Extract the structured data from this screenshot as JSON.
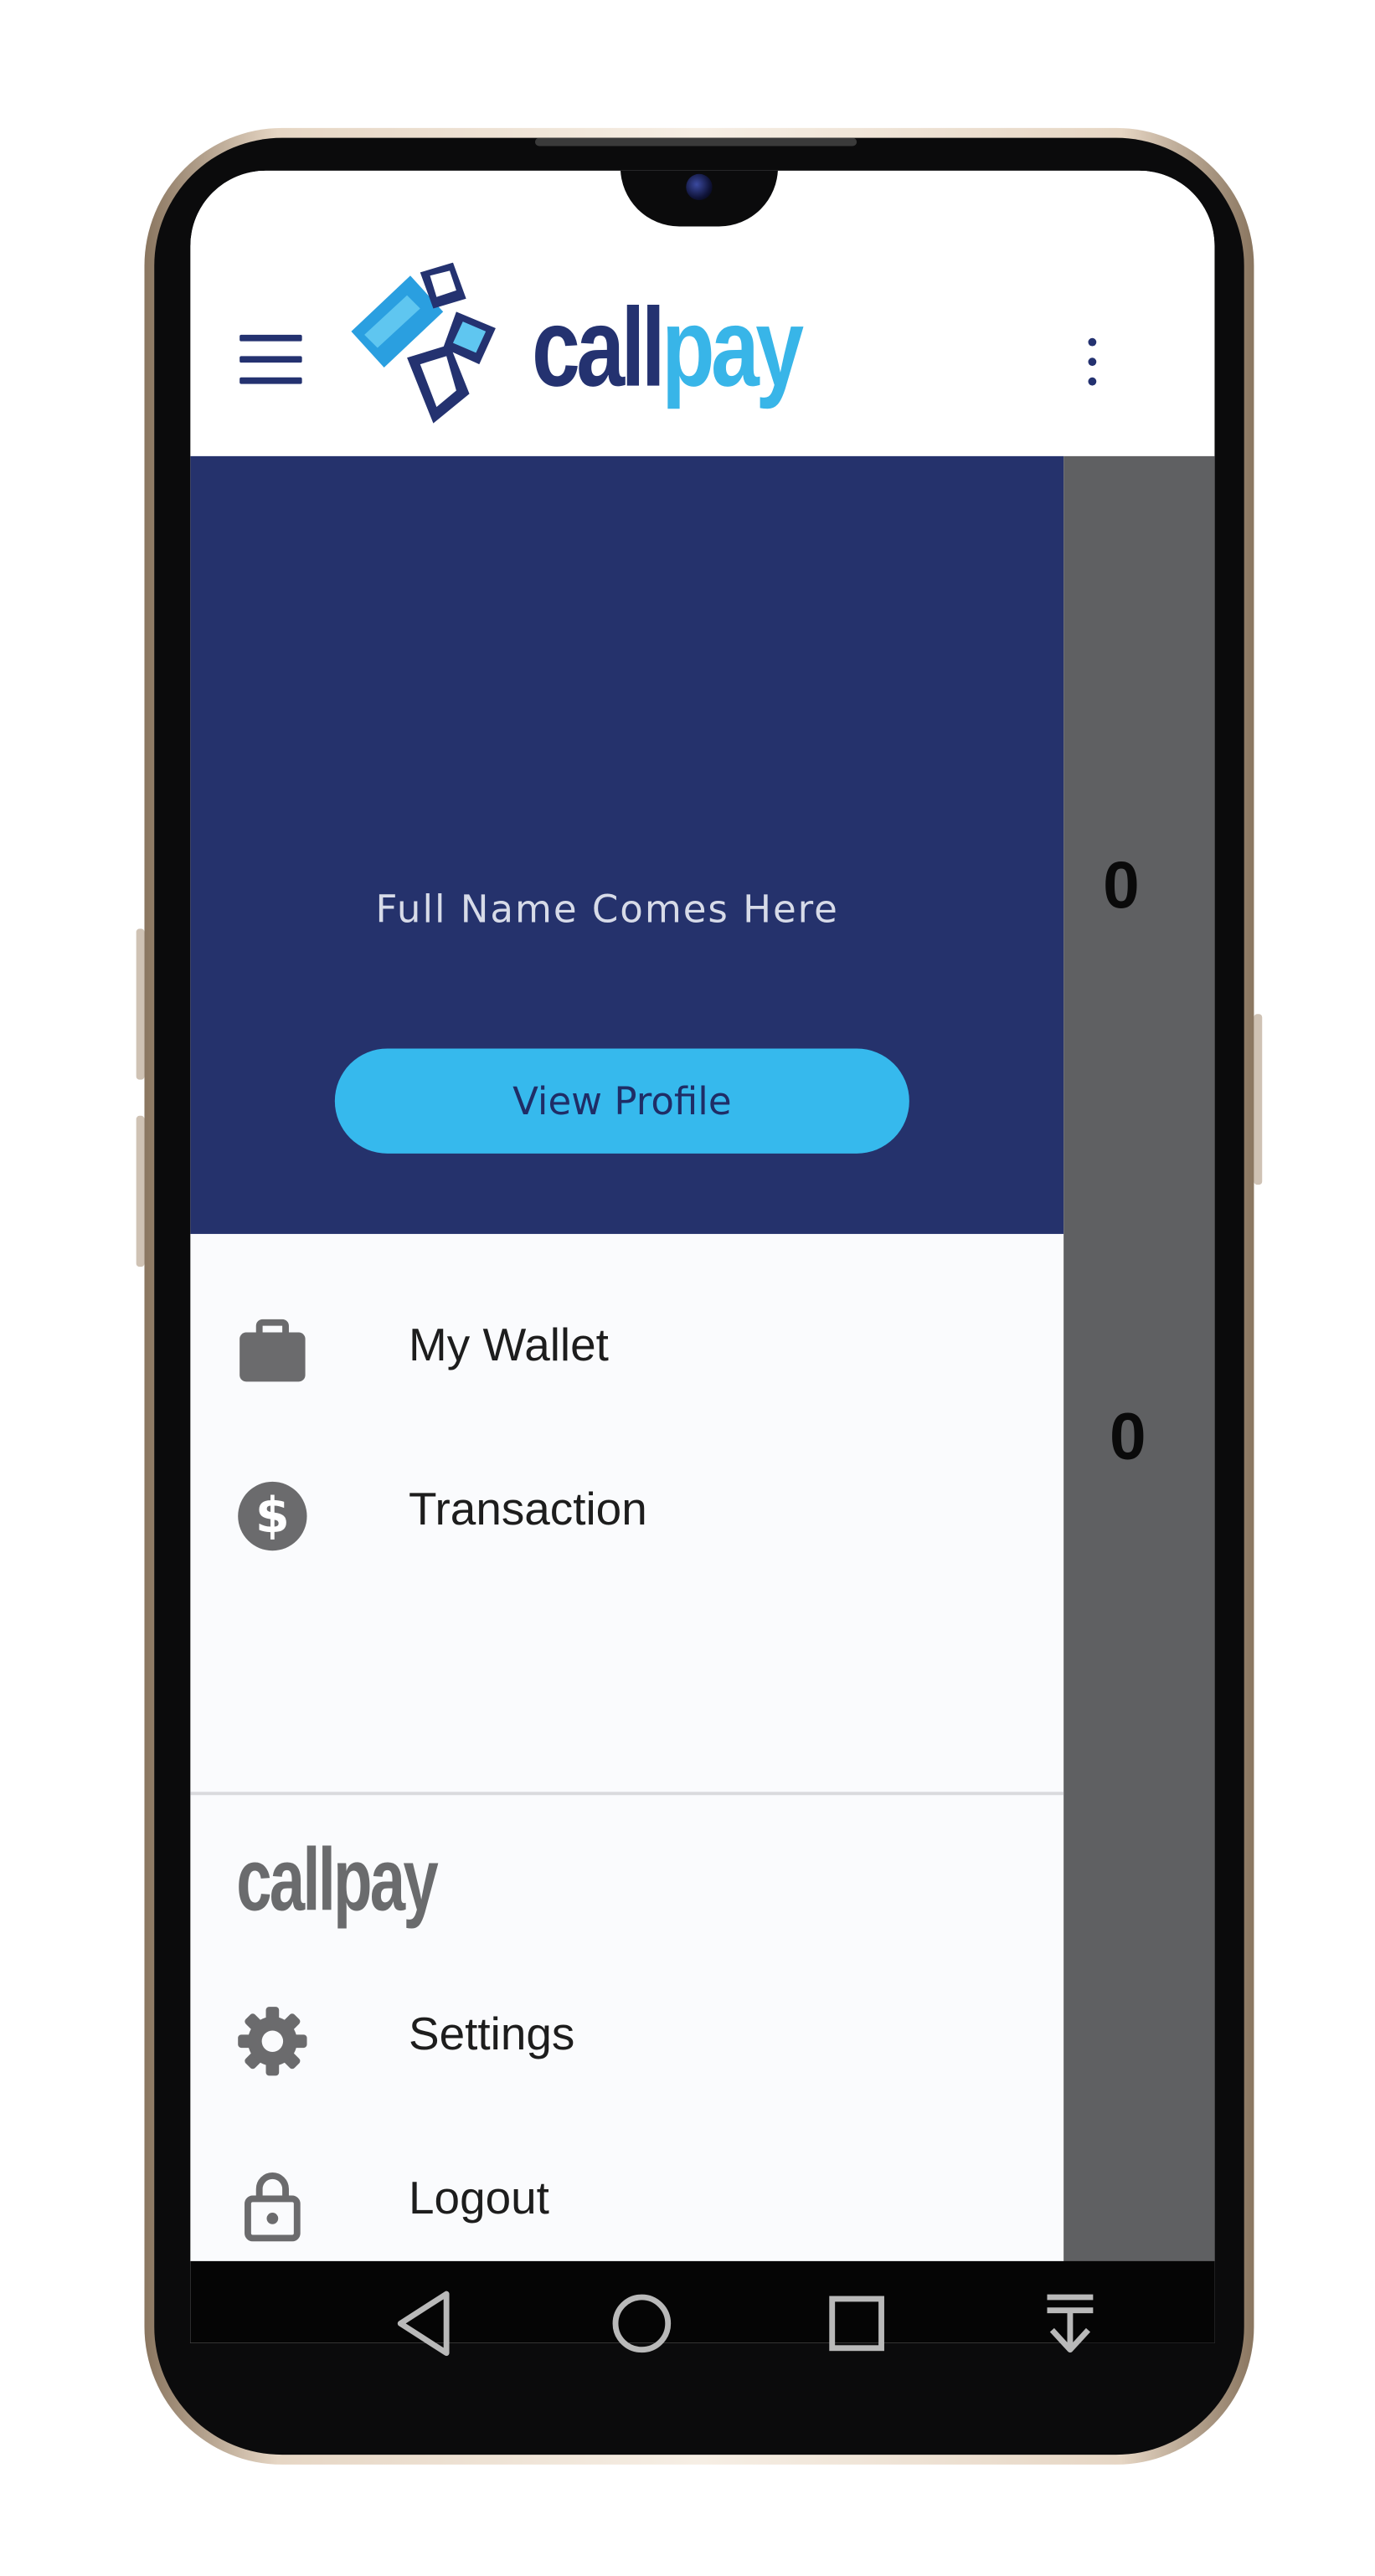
{
  "app": {
    "brand_call": "call",
    "brand_pay": "pay",
    "colors": {
      "primary": "#25326c",
      "accent": "#36b9ed",
      "scrim": "#5f6062",
      "icon_gray": "#6b6b6d"
    },
    "icons": {
      "menu": "hamburger-menu-icon",
      "overflow": "more-vert-icon"
    }
  },
  "drawer": {
    "header": {
      "full_name": "Full Name Comes Here",
      "view_profile_label": "View Profile"
    },
    "menu_items": [
      {
        "label": "My Wallet",
        "icon": "briefcase-icon"
      },
      {
        "label": "Transaction",
        "icon": "dollar-circle-icon"
      }
    ],
    "section_title": "callpay",
    "secondary_items": [
      {
        "label": "Settings",
        "icon": "gear-icon"
      },
      {
        "label": "Logout",
        "icon": "lock-icon"
      }
    ]
  },
  "background_values": [
    "0",
    "0"
  ],
  "navigation_bar": {
    "buttons": [
      "back-icon",
      "home-icon",
      "recents-icon",
      "notifications-pull-icon"
    ]
  }
}
